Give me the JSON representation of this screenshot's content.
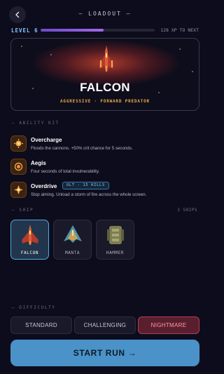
{
  "header": {
    "back_icon": "arrow-left-icon",
    "title": "— LOADOUT —"
  },
  "progress": {
    "level_label": "LEVEL 6",
    "xp_fraction": 0.55,
    "xp_text": "128 XP TO NEXT"
  },
  "hero": {
    "ship_name": "FALCON",
    "tagline": "AGGRESSIVE · FORWARD PREDATOR",
    "glow_color": "#e04832"
  },
  "ability_kit": {
    "label": "— ABILITY KIT",
    "items": [
      {
        "name": "Overcharge",
        "description": "Floods the cannons. +50% crit chance for 5 seconds.",
        "icon": "overcharge-icon"
      },
      {
        "name": "Aegis",
        "description": "Four seconds of total invulnerability.",
        "icon": "aegis-icon"
      },
      {
        "name": "Overdrive",
        "badge": "ULT · 15 KILLS",
        "description": "Stop aiming. Unload a storm of fire across the whole screen.",
        "icon": "overdrive-icon"
      }
    ]
  },
  "ships": {
    "label": "— SHIP",
    "count": "3 SHIPS",
    "selected": "FALCON",
    "items": [
      {
        "name": "FALCON",
        "color": "#c84a3a"
      },
      {
        "name": "MANTA",
        "color": "#4d93a8"
      },
      {
        "name": "HAMMER",
        "color": "#8a8a5a"
      }
    ]
  },
  "difficulty": {
    "label": "— DIFFICULTY",
    "options": [
      "STANDARD",
      "CHALLENGING",
      "NIGHTMARE"
    ],
    "selected": "NIGHTMARE"
  },
  "start": {
    "label": "START RUN",
    "arrow": "→",
    "color": "#4a92c7"
  }
}
